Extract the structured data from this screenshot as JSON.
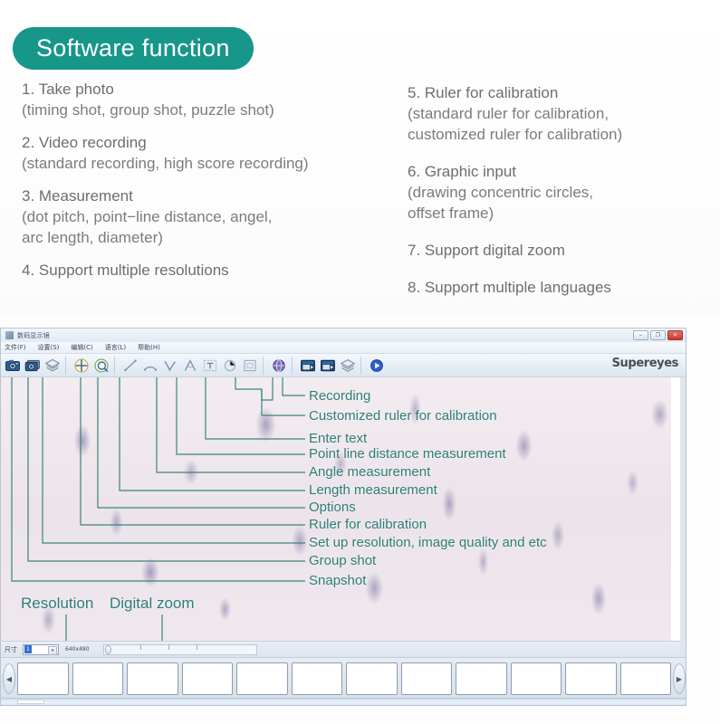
{
  "header": {
    "badge_title": "Software function",
    "badge_color": "#17968a",
    "accent_color": "#2c7f76"
  },
  "features": {
    "left": [
      {
        "head": "1. Take photo",
        "sub": [
          "(timing shot, group shot, puzzle shot)"
        ]
      },
      {
        "head": "2. Video recording",
        "sub": [
          "(standard recording, high score recording)"
        ]
      },
      {
        "head": "3. Measurement",
        "sub": [
          "(dot pitch, point−line distance, angel,",
          "arc length, diameter)"
        ]
      },
      {
        "head": "4. Support multiple resolutions",
        "sub": []
      }
    ],
    "right": [
      {
        "head": "5. Ruler for calibration",
        "sub": [
          "(standard ruler for calibration,",
          "customized ruler for calibration)"
        ]
      },
      {
        "head": "6. Graphic input",
        "sub": [
          "(drawing concentric circles,",
          "offset frame)"
        ]
      },
      {
        "head": "7. Support digital zoom",
        "sub": []
      },
      {
        "head": "8. Support multiple languages",
        "sub": []
      }
    ]
  },
  "app": {
    "window_title": "数码显示镜",
    "brand": "Supereyes",
    "window_buttons": [
      {
        "name": "minimize",
        "glyph": "–"
      },
      {
        "name": "maximize",
        "glyph": "❐"
      },
      {
        "name": "close",
        "glyph": "✕"
      }
    ],
    "menu": [
      "文件(F)",
      "设置(S)",
      "编辑(C)",
      "语言(L)",
      "帮助(H)"
    ],
    "toolbar": [
      {
        "name": "snapshot-icon",
        "kind": "camera-blue"
      },
      {
        "name": "group-shot-icon",
        "kind": "camera-stack"
      },
      {
        "name": "setup-resolution-icon",
        "kind": "layers"
      },
      {
        "name": "ruler-for-calibration-icon",
        "kind": "crosshair"
      },
      {
        "name": "options-icon",
        "kind": "target"
      },
      {
        "name": "length-measurement-icon",
        "kind": "line"
      },
      {
        "name": "arc-measurement-icon",
        "kind": "arc"
      },
      {
        "name": "angle-measurement-icon",
        "kind": "angle-v"
      },
      {
        "name": "point-line-distance-icon",
        "kind": "angle-a"
      },
      {
        "name": "enter-text-icon",
        "kind": "text-box"
      },
      {
        "name": "circle-tool-icon",
        "kind": "circle"
      },
      {
        "name": "rect-tool-icon",
        "kind": "square"
      },
      {
        "name": "customized-ruler-icon",
        "kind": "globe"
      },
      {
        "name": "recording-icon",
        "kind": "video-1"
      },
      {
        "name": "recording-stop-icon",
        "kind": "video-2"
      },
      {
        "name": "layers-2-icon",
        "kind": "layers2"
      },
      {
        "name": "play-icon",
        "kind": "play"
      }
    ],
    "callouts": [
      "Recording",
      "Customized ruler for calibration",
      "Enter text",
      "Point line distance measurement",
      "Angle measurement",
      "Length measurement",
      "Options",
      "Ruler for calibration",
      "Set up resolution, image quality and etc",
      "Group shot",
      "Snapshot"
    ],
    "viewport_captions": [
      "Resolution",
      "Digital zoom"
    ],
    "controls": {
      "label": "尺寸",
      "resolution_value": "1",
      "resolution_text": "640x480",
      "dropdown_arrow": "▾"
    },
    "filmstrip": {
      "prev_arrow": "◀",
      "next_arrow": "▶",
      "thumb_count": 12
    }
  }
}
